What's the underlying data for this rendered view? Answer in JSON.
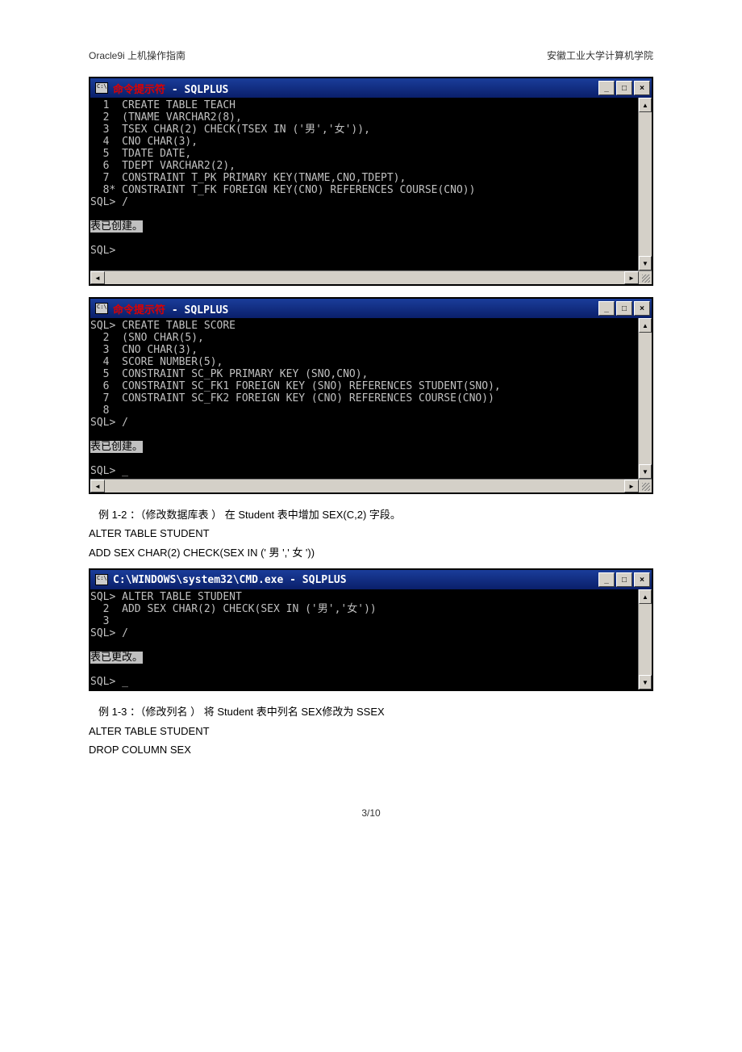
{
  "header": {
    "left": "Oracle9i  上机操作指南",
    "right": "安徽工业大学计算机学院"
  },
  "terminal1": {
    "title_prefix": "命令提示符",
    "title_suffix": " - SQLPLUS",
    "lines": [
      "  1  CREATE TABLE TEACH",
      "  2  (TNAME VARCHAR2(8),",
      "  3  TSEX CHAR(2) CHECK(TSEX IN ('男','女')),",
      "  4  CNO CHAR(3),",
      "  5  TDATE DATE,",
      "  6  TDEPT VARCHAR2(2),",
      "  7  CONSTRAINT T_PK PRIMARY KEY(TNAME,CNO,TDEPT),",
      "  8* CONSTRAINT T_FK FOREIGN KEY(CNO) REFERENCES COURSE(CNO))",
      "SQL> /",
      "",
      "表已创建。",
      "",
      "SQL>",
      ""
    ],
    "highlight_line": 10
  },
  "terminal2": {
    "title_prefix": "命令提示符",
    "title_suffix": " - SQLPLUS",
    "lines": [
      "SQL> CREATE TABLE SCORE",
      "  2  (SNO CHAR(5),",
      "  3  CNO CHAR(3),",
      "  4  SCORE NUMBER(5),",
      "  5  CONSTRAINT SC_PK PRIMARY KEY (SNO,CNO),",
      "  6  CONSTRAINT SC_FK1 FOREIGN KEY (SNO) REFERENCES STUDENT(SNO),",
      "  7  CONSTRAINT SC_FK2 FOREIGN KEY (CNO) REFERENCES COURSE(CNO))",
      "  8",
      "SQL> /",
      "",
      "表已创建。",
      "",
      "SQL> _"
    ],
    "highlight_line": 10
  },
  "text1": {
    "line1": "例 1-2 ：（修改数据库表 ）  在 Student  表中增加  SEX(C,2)  字段。",
    "line2": "ALTER TABLE STUDENT",
    "line3": "ADD SEX CHAR(2) CHECK(SEX IN (' 男 ','  女 '))"
  },
  "terminal3": {
    "title": "C:\\WINDOWS\\system32\\CMD.exe - SQLPLUS",
    "lines": [
      "SQL> ALTER TABLE STUDENT",
      "  2  ADD SEX CHAR(2) CHECK(SEX IN ('男','女'))",
      "  3",
      "SQL> /",
      "",
      "表已更改。",
      "",
      "SQL> _"
    ],
    "highlight_line": 5
  },
  "text2": {
    "line1": "例 1-3 ：（修改列名 ）  将 Student  表中列名  SEX修改为 SSEX",
    "line2": "ALTER TABLE STUDENT",
    "line3": "DROP COLUMN SEX"
  },
  "footer": {
    "page": "3/10"
  },
  "winbtns": {
    "min": "_",
    "max": "□",
    "close": "×"
  },
  "arrows": {
    "up": "▲",
    "down": "▼",
    "left": "◄",
    "right": "►"
  }
}
